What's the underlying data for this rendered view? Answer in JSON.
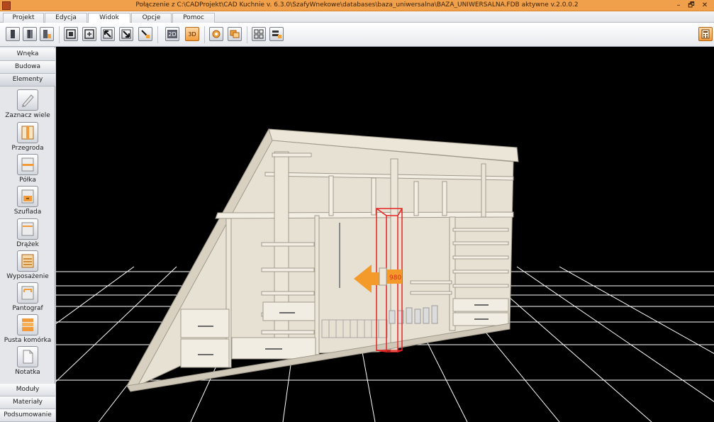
{
  "window": {
    "title": "Połączenie z C:\\CADProjekt\\CAD Kuchnie v. 6.3.0\\SzafyWnekowe\\databases\\baza_uniwersalna\\BAZA_UNIWERSALNA.FDB aktywne  v.2.0.0.2",
    "minimize": "–",
    "restore": "🗗",
    "close": "✕"
  },
  "menu": {
    "tabs": [
      {
        "label": "Projekt"
      },
      {
        "label": "Edycja"
      },
      {
        "label": "Widok",
        "active": true
      },
      {
        "label": "Opcje"
      },
      {
        "label": "Pomoc"
      }
    ]
  },
  "toolbar": {
    "buttons": [
      {
        "id": "view-front",
        "icon": "panel-front-icon"
      },
      {
        "id": "view-side",
        "icon": "panel-side-icon"
      },
      {
        "id": "view-lock",
        "icon": "panel-lock-icon"
      },
      {
        "id": "fit-a",
        "icon": "fit-view-icon"
      },
      {
        "id": "fit-b",
        "icon": "fit-view-2-icon"
      },
      {
        "id": "move-up",
        "icon": "arrow-nw-icon"
      },
      {
        "id": "move-down",
        "icon": "arrow-se-icon"
      },
      {
        "id": "move-lock",
        "icon": "arrow-lock-icon"
      },
      {
        "id": "mode-2d",
        "label": "2D",
        "icon": "mode-2d-icon"
      },
      {
        "id": "mode-3d",
        "label": "3D",
        "icon": "mode-3d-icon"
      },
      {
        "id": "settings",
        "icon": "settings-gear-icon"
      },
      {
        "id": "windows",
        "icon": "windows-icon"
      },
      {
        "id": "grid",
        "icon": "grid-icon"
      },
      {
        "id": "layers",
        "icon": "layers-lock-icon"
      },
      {
        "id": "calculator",
        "icon": "calculator-icon"
      }
    ]
  },
  "sidebar": {
    "top_categories": [
      {
        "label": "Wnęka"
      },
      {
        "label": "Budowa"
      },
      {
        "label": "Elementy",
        "active": true
      }
    ],
    "tools": [
      {
        "label": "Zaznacz wiele",
        "icon": "select-multiple-icon"
      },
      {
        "label": "Przegroda",
        "icon": "partition-icon"
      },
      {
        "label": "Półka",
        "icon": "shelf-icon"
      },
      {
        "label": "Szuflada",
        "icon": "drawer-icon"
      },
      {
        "label": "Drążek",
        "icon": "rail-icon"
      },
      {
        "label": "Wyposażenie",
        "icon": "equipment-icon"
      },
      {
        "label": "Pantograf",
        "icon": "pantograph-icon"
      },
      {
        "label": "Pusta komórka",
        "icon": "empty-cell-icon"
      },
      {
        "label": "Notatka",
        "icon": "note-icon"
      }
    ],
    "bottom_categories": [
      {
        "label": "Moduły"
      },
      {
        "label": "Materiały"
      },
      {
        "label": "Podsumowanie"
      }
    ]
  },
  "viewport": {
    "dimension_label": "980",
    "colors": {
      "background": "#000000",
      "grid": "#ffffff",
      "board": "#ece6d9",
      "edge": "#a09a8c",
      "highlight": "#e52222",
      "arrow": "#f39a2b"
    }
  }
}
